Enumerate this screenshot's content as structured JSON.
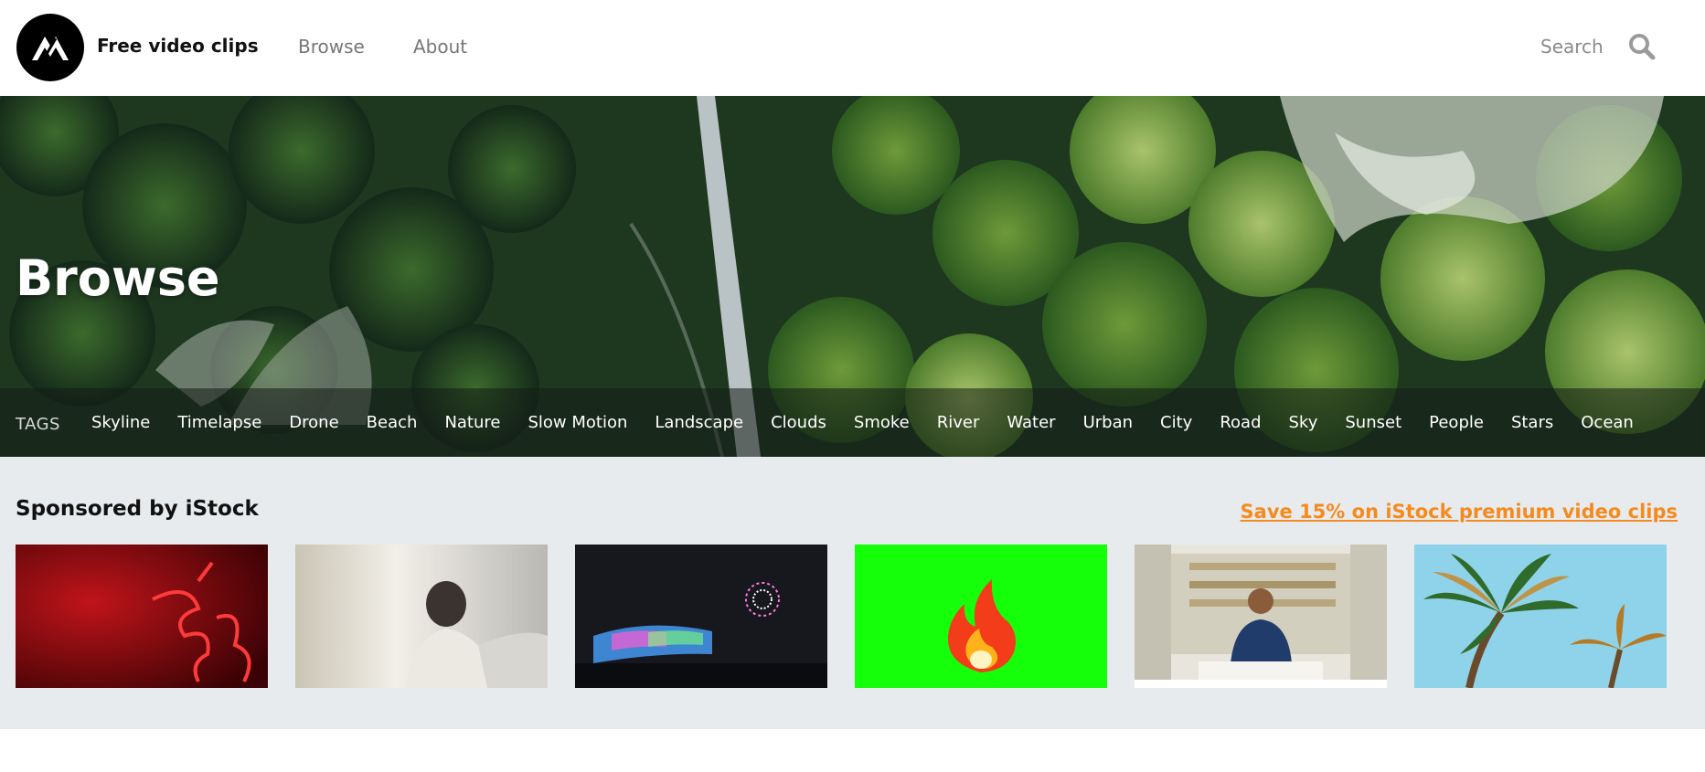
{
  "header": {
    "brand": "Free video clips",
    "nav": [
      {
        "label": "Browse"
      },
      {
        "label": "About"
      }
    ],
    "search_placeholder": "Search",
    "logo_icon": "mixkit-logo-icon",
    "search_icon": "search-icon"
  },
  "hero": {
    "title": "Browse",
    "tags_label": "TAGS",
    "tags": [
      "Skyline",
      "Timelapse",
      "Drone",
      "Beach",
      "Nature",
      "Slow Motion",
      "Landscape",
      "Clouds",
      "Smoke",
      "River",
      "Water",
      "Urban",
      "City",
      "Road",
      "Sky",
      "Sunset",
      "People",
      "Stars",
      "Ocean"
    ]
  },
  "sponsored": {
    "title": "Sponsored by iStock",
    "promo_link": "Save 15% on iStock premium video clips",
    "promo_color": "#f58a1f",
    "thumbnails": [
      {
        "subject": "red neon sign"
      },
      {
        "subject": "woman by window"
      },
      {
        "subject": "Niagara Falls fireworks"
      },
      {
        "subject": "fire emoji on green screen"
      },
      {
        "subject": "man writing at shop counter"
      },
      {
        "subject": "palm trees against sky"
      }
    ]
  }
}
